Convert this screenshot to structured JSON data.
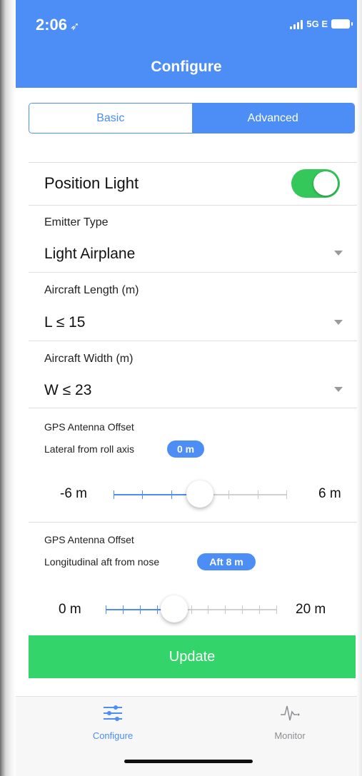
{
  "status_bar": {
    "time": "2:06",
    "location_glyph": "➶",
    "network": "5G E"
  },
  "header": {
    "title": "Configure"
  },
  "segments": {
    "basic": "Basic",
    "advanced": "Advanced",
    "selected": "Advanced"
  },
  "position_light": {
    "label": "Position Light",
    "enabled": true
  },
  "emitter_type": {
    "caption": "Emitter Type",
    "value": "Light Airplane"
  },
  "aircraft_length": {
    "caption": "Aircraft Length (m)",
    "value": "L ≤ 15"
  },
  "aircraft_width": {
    "caption": "Aircraft Width (m)",
    "value": "W ≤ 23"
  },
  "lateral_offset": {
    "title": "GPS Antenna Offset",
    "caption": "Lateral from roll axis",
    "badge": "0 m",
    "min_label": "-6 m",
    "max_label": "6 m",
    "value": 0,
    "min": -6,
    "max": 6
  },
  "longitudinal_offset": {
    "title": "GPS Antenna Offset",
    "caption": "Longitudinal aft from nose",
    "badge": "Aft 8 m",
    "min_label": "0 m",
    "max_label": "20 m",
    "value": 8,
    "min": 0,
    "max": 20
  },
  "update_button": {
    "label": "Update"
  },
  "tabbar": {
    "configure": "Configure",
    "monitor": "Monitor",
    "selected": "Configure"
  },
  "colors": {
    "accent": "#4c8df6",
    "toggle_on": "#34c759",
    "update": "#33d46a"
  }
}
